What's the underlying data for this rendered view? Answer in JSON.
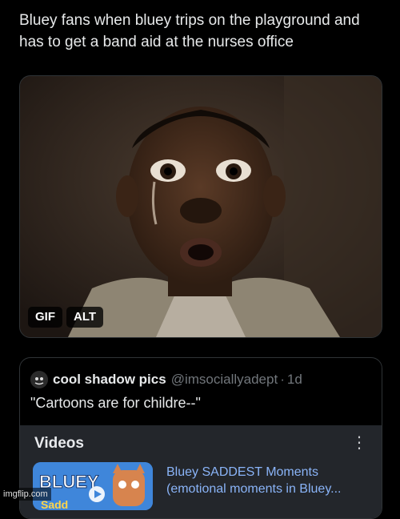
{
  "post": {
    "text": "Bluey fans when bluey trips on the playground and has to get a band aid at the nurses office",
    "media": {
      "icon": "crying-face-photo",
      "badges": [
        "GIF",
        "ALT"
      ]
    }
  },
  "quoted_post": {
    "display_name": "cool shadow pics",
    "handle": "@imsociallyadept",
    "separator": "·",
    "time": "1d",
    "text": "\"Cartoons are for childre--\"",
    "embed": {
      "section_title": "Videos",
      "menu_icon": "kebab-menu-icon",
      "video_title_line1": "Bluey SADDEST Moments",
      "video_title_line2": "(emotional moments in Bluey...",
      "thumbnail_text": "BLUEY",
      "thumbnail_subtext": "Sadd"
    }
  },
  "watermark": "imgflip.com",
  "colors": {
    "background": "#000000",
    "text": "#e7e9ea",
    "muted": "#71767b",
    "link": "#8ab4f8",
    "embed_bg": "#23262b"
  }
}
